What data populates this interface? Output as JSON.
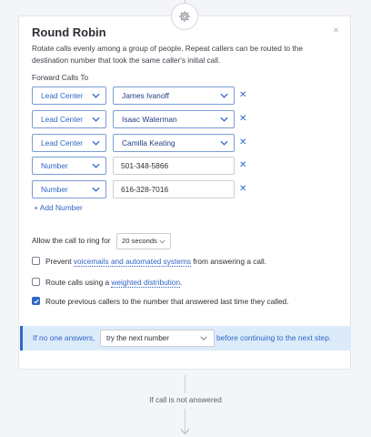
{
  "card": {
    "title": "Round Robin",
    "description": "Rotate calls evenly among a group of people. Repeat callers can be routed to the destination number that took the same caller's initial call.",
    "close_icon": "×"
  },
  "forward": {
    "label": "Forward Calls To",
    "rows": [
      {
        "type": "Lead Center",
        "target": "James Ivanoff",
        "target_kind": "select"
      },
      {
        "type": "Lead Center",
        "target": "Isaac Waterman",
        "target_kind": "select"
      },
      {
        "type": "Lead Center",
        "target": "Camilla Keating",
        "target_kind": "select"
      },
      {
        "type": "Number",
        "target": "501-348-5866",
        "target_kind": "text"
      },
      {
        "type": "Number",
        "target": "616-328-7016",
        "target_kind": "text"
      }
    ],
    "remove_icon": "✕",
    "add_label": "+ Add Number"
  },
  "ring": {
    "label": "Allow the call to ring for",
    "value": "20 seconds"
  },
  "options": {
    "voicemail_pre": "Prevent ",
    "voicemail_link": "voicemails and automated systems",
    "voicemail_post": " from answering a call.",
    "voicemail_checked": false,
    "weighted_pre": "Route calls using a ",
    "weighted_link": "weighted distribution",
    "weighted_post": ".",
    "weighted_checked": false,
    "previous_text": "Route previous callers to the number that answered last time they called.",
    "previous_checked": true
  },
  "banner": {
    "pre": "If no one answers,",
    "select_value": "try the next number",
    "post": "before continuing to the next step."
  },
  "flow": {
    "not_answered": "If call is not answered"
  },
  "colors": {
    "accent": "#2f66c6",
    "banner_bg": "#dcebf9"
  },
  "icons": {
    "top_node": "gear-icon",
    "dropdown": "chevron-down-icon",
    "remove": "close-icon",
    "flow_arrow": "arrow-down-icon"
  }
}
